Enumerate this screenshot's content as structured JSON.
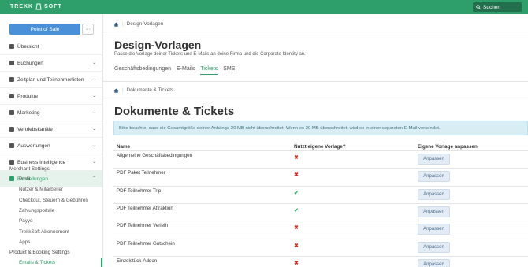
{
  "topbar": {
    "logo_left": "TREKK",
    "logo_right": "SOFT",
    "search_label": "Suchen"
  },
  "sidebar": {
    "pos_label": "Point of Sale",
    "more_label": "···",
    "items": [
      {
        "label": "Übersicht",
        "chev": false
      },
      {
        "label": "Buchungen",
        "chev": true
      },
      {
        "label": "Zeitplan und Teilnehmerlisten",
        "chev": true
      },
      {
        "label": "Produkte",
        "chev": true
      },
      {
        "label": "Marketing",
        "chev": true
      },
      {
        "label": "Vertriebskanäle",
        "chev": true
      },
      {
        "label": "Auswertungen",
        "chev": true
      },
      {
        "label": "Business Intelligence",
        "chev": true
      },
      {
        "label": "Einstellungen",
        "chev": true
      }
    ],
    "merchant_heading": "Merchant Settings",
    "merchant_items": [
      "Profil",
      "Nutzer & Mitarbeiter",
      "Checkout, Steuern & Gebühren",
      "Zahlungsportale",
      "Payyo",
      "TrekkSoft Abonnement",
      "Apps"
    ],
    "product_heading": "Product & Booking Settings",
    "product_items": [
      "Emails & Tickets"
    ]
  },
  "breadcrumb1": "Design-Vorlagen",
  "page_title": "Design-Vorlagen",
  "page_desc": "Passe die Vorlage deiner Tickets und E-Mails an deine Firma und die Corporate Identity an.",
  "tabs": [
    "Geschäftsbedingungen",
    "E-Mails",
    "Tickets",
    "SMS"
  ],
  "active_tab": "Tickets",
  "breadcrumb2": "Dokumente & Tickets",
  "section_title": "Dokumente & Tickets",
  "notice": "Bitte beachte, dass die Gesamtgröße deiner Anhänge 20 MB nicht überschreitet. Wenn es 20 MB überschreitet, wird es in einer separaten E-Mail versendet.",
  "table": {
    "headers": [
      "Name",
      "Nutzt eigene Vorlage?",
      "Eigene Vorlage anpassen"
    ],
    "rows": [
      {
        "name": "Allgemeine Geschäftsbedingungen",
        "custom": false,
        "action": "Anpassen"
      },
      {
        "name": "PDF Paket Teilnehmer",
        "custom": false,
        "action": "Anpassen"
      },
      {
        "name": "PDF Teilnehmer Trip",
        "custom": true,
        "action": "Anpassen"
      },
      {
        "name": "PDF Teilnehmer Attraktion",
        "custom": true,
        "action": "Anpassen"
      },
      {
        "name": "PDF Teilnehmer Verleih",
        "custom": false,
        "action": "Anpassen"
      },
      {
        "name": "PDF Teilnehmer Gutschein",
        "custom": false,
        "action": "Anpassen"
      },
      {
        "name": "Einzelstück-Addon",
        "custom": false,
        "action": "Anpassen"
      }
    ]
  },
  "colors": {
    "brand": "#2e9e6a",
    "primary_button": "#4a90d9",
    "notice_bg": "#d9eef4"
  }
}
